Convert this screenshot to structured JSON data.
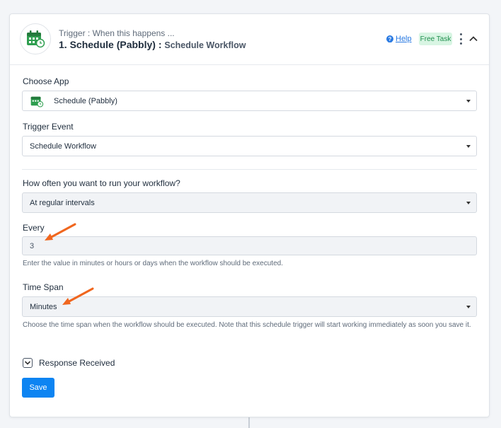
{
  "trigger": {
    "subtitle": "Trigger : When this happens ...",
    "title_prefix": "1. Schedule (Pabbly) :",
    "title_event": "Schedule Workflow",
    "help_label": "Help",
    "badge": "Free Task"
  },
  "form": {
    "choose_app_label": "Choose App",
    "choose_app_value": "Schedule (Pabbly)",
    "trigger_event_label": "Trigger Event",
    "trigger_event_value": "Schedule Workflow",
    "frequency_label": "How often you want to run your workflow?",
    "frequency_value": "At regular intervals",
    "every_label": "Every",
    "every_value": "3",
    "every_help": "Enter the value in minutes or hours or days when the workflow should be executed.",
    "time_span_label": "Time Span",
    "time_span_value": "Minutes",
    "time_span_help": "Choose the time span when the workflow should be executed. Note that this schedule trigger will start working immediately as soon you save it.",
    "response_label": "Response Received",
    "save_label": "Save"
  },
  "icons": {
    "app": "calendar-clock-icon",
    "help": "question-circle-icon",
    "menu": "kebab-icon",
    "collapse": "chevron-up-icon",
    "dropdown": "caret-down-icon",
    "response_toggle": "chevron-down-icon",
    "annotation": "arrow-icon"
  },
  "colors": {
    "accent": "#0d84f2",
    "app_green": "#2e9e4f",
    "badge_bg": "#d8f5e3",
    "badge_text": "#1f8f4d",
    "annotation_arrow": "#f0661e"
  }
}
